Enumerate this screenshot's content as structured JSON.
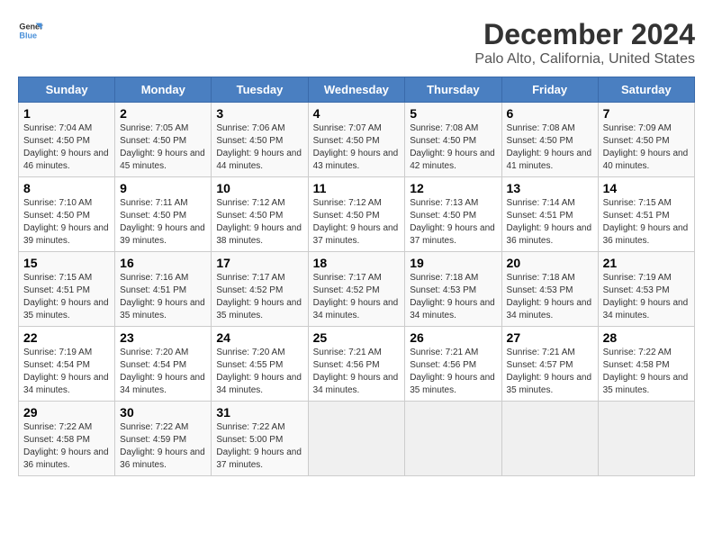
{
  "logo": {
    "line1": "General",
    "line2": "Blue"
  },
  "title": "December 2024",
  "subtitle": "Palo Alto, California, United States",
  "days_of_week": [
    "Sunday",
    "Monday",
    "Tuesday",
    "Wednesday",
    "Thursday",
    "Friday",
    "Saturday"
  ],
  "weeks": [
    [
      {
        "num": "1",
        "rise": "7:04 AM",
        "set": "4:50 PM",
        "daylight": "9 hours and 46 minutes."
      },
      {
        "num": "2",
        "rise": "7:05 AM",
        "set": "4:50 PM",
        "daylight": "9 hours and 45 minutes."
      },
      {
        "num": "3",
        "rise": "7:06 AM",
        "set": "4:50 PM",
        "daylight": "9 hours and 44 minutes."
      },
      {
        "num": "4",
        "rise": "7:07 AM",
        "set": "4:50 PM",
        "daylight": "9 hours and 43 minutes."
      },
      {
        "num": "5",
        "rise": "7:08 AM",
        "set": "4:50 PM",
        "daylight": "9 hours and 42 minutes."
      },
      {
        "num": "6",
        "rise": "7:08 AM",
        "set": "4:50 PM",
        "daylight": "9 hours and 41 minutes."
      },
      {
        "num": "7",
        "rise": "7:09 AM",
        "set": "4:50 PM",
        "daylight": "9 hours and 40 minutes."
      }
    ],
    [
      {
        "num": "8",
        "rise": "7:10 AM",
        "set": "4:50 PM",
        "daylight": "9 hours and 39 minutes."
      },
      {
        "num": "9",
        "rise": "7:11 AM",
        "set": "4:50 PM",
        "daylight": "9 hours and 39 minutes."
      },
      {
        "num": "10",
        "rise": "7:12 AM",
        "set": "4:50 PM",
        "daylight": "9 hours and 38 minutes."
      },
      {
        "num": "11",
        "rise": "7:12 AM",
        "set": "4:50 PM",
        "daylight": "9 hours and 37 minutes."
      },
      {
        "num": "12",
        "rise": "7:13 AM",
        "set": "4:50 PM",
        "daylight": "9 hours and 37 minutes."
      },
      {
        "num": "13",
        "rise": "7:14 AM",
        "set": "4:51 PM",
        "daylight": "9 hours and 36 minutes."
      },
      {
        "num": "14",
        "rise": "7:15 AM",
        "set": "4:51 PM",
        "daylight": "9 hours and 36 minutes."
      }
    ],
    [
      {
        "num": "15",
        "rise": "7:15 AM",
        "set": "4:51 PM",
        "daylight": "9 hours and 35 minutes."
      },
      {
        "num": "16",
        "rise": "7:16 AM",
        "set": "4:51 PM",
        "daylight": "9 hours and 35 minutes."
      },
      {
        "num": "17",
        "rise": "7:17 AM",
        "set": "4:52 PM",
        "daylight": "9 hours and 35 minutes."
      },
      {
        "num": "18",
        "rise": "7:17 AM",
        "set": "4:52 PM",
        "daylight": "9 hours and 34 minutes."
      },
      {
        "num": "19",
        "rise": "7:18 AM",
        "set": "4:53 PM",
        "daylight": "9 hours and 34 minutes."
      },
      {
        "num": "20",
        "rise": "7:18 AM",
        "set": "4:53 PM",
        "daylight": "9 hours and 34 minutes."
      },
      {
        "num": "21",
        "rise": "7:19 AM",
        "set": "4:53 PM",
        "daylight": "9 hours and 34 minutes."
      }
    ],
    [
      {
        "num": "22",
        "rise": "7:19 AM",
        "set": "4:54 PM",
        "daylight": "9 hours and 34 minutes."
      },
      {
        "num": "23",
        "rise": "7:20 AM",
        "set": "4:54 PM",
        "daylight": "9 hours and 34 minutes."
      },
      {
        "num": "24",
        "rise": "7:20 AM",
        "set": "4:55 PM",
        "daylight": "9 hours and 34 minutes."
      },
      {
        "num": "25",
        "rise": "7:21 AM",
        "set": "4:56 PM",
        "daylight": "9 hours and 34 minutes."
      },
      {
        "num": "26",
        "rise": "7:21 AM",
        "set": "4:56 PM",
        "daylight": "9 hours and 35 minutes."
      },
      {
        "num": "27",
        "rise": "7:21 AM",
        "set": "4:57 PM",
        "daylight": "9 hours and 35 minutes."
      },
      {
        "num": "28",
        "rise": "7:22 AM",
        "set": "4:58 PM",
        "daylight": "9 hours and 35 minutes."
      }
    ],
    [
      {
        "num": "29",
        "rise": "7:22 AM",
        "set": "4:58 PM",
        "daylight": "9 hours and 36 minutes."
      },
      {
        "num": "30",
        "rise": "7:22 AM",
        "set": "4:59 PM",
        "daylight": "9 hours and 36 minutes."
      },
      {
        "num": "31",
        "rise": "7:22 AM",
        "set": "5:00 PM",
        "daylight": "9 hours and 37 minutes."
      },
      null,
      null,
      null,
      null
    ]
  ]
}
